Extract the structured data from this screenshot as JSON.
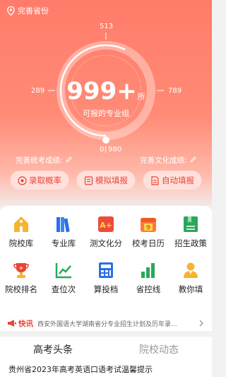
{
  "location": {
    "label": "完善省份",
    "icon": "location-pin-icon"
  },
  "dial": {
    "value": "999+",
    "unit": "所",
    "caption": "可报的专业组",
    "tick_top": "513",
    "tick_left": "289",
    "tick_right": "789",
    "tick_bottom_left": "0",
    "tick_bottom_right": "980",
    "progress": 0.57
  },
  "scores": {
    "left": "完善统考成绩:",
    "right": "完善文化成绩:"
  },
  "actions": [
    {
      "label": "录取概率",
      "icon": "target-icon"
    },
    {
      "label": "模拟填报",
      "icon": "form-icon"
    },
    {
      "label": "自动填报",
      "icon": "document-icon"
    }
  ],
  "grid": [
    {
      "label": "院校库",
      "icon": "school-icon"
    },
    {
      "label": "专业库",
      "icon": "books-icon"
    },
    {
      "label": "测文化分",
      "icon": "grade-icon"
    },
    {
      "label": "校考日历",
      "icon": "calendar-icon"
    },
    {
      "label": "招生政策",
      "icon": "policy-icon"
    },
    {
      "label": "院校排名",
      "icon": "trophy-icon"
    },
    {
      "label": "查位次",
      "icon": "trend-icon"
    },
    {
      "label": "算投档",
      "icon": "calculator-icon"
    },
    {
      "label": "省控线",
      "icon": "bar-chart-icon"
    },
    {
      "label": "教你填",
      "icon": "teacher-icon"
    }
  ],
  "news": {
    "tag": "快讯",
    "text": "西安外国语大学湖南省分专业招生计划及历年录..."
  },
  "tabs": [
    "高考头条",
    "院校动态"
  ],
  "headline": "贵州省2023年高考英语口语考试温馨提示",
  "colors": {
    "accent": "#e8443a",
    "hero_top": "#ff7c6a"
  }
}
